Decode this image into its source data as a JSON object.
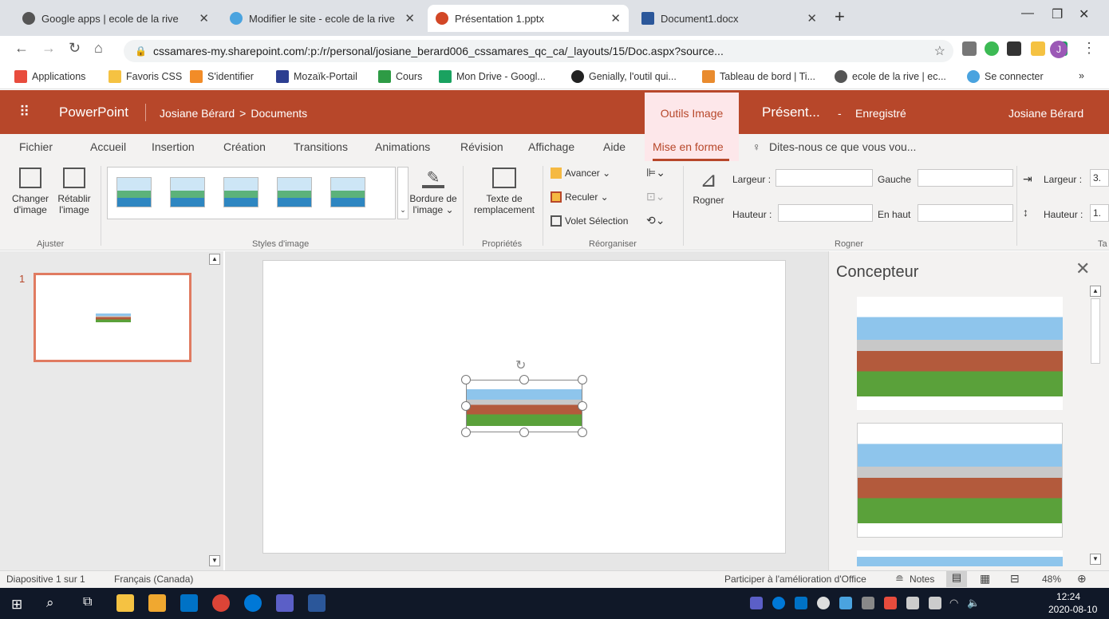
{
  "browser": {
    "tabs": [
      {
        "label": "Google apps | ecole de la rive",
        "color": "#555555"
      },
      {
        "label": "Modifier le site - ecole de la rive",
        "color": "#4aa3df"
      },
      {
        "label": "Présentation 1.pptx",
        "color": "#d24726"
      },
      {
        "label": "Document1.docx",
        "color": "#2b579a"
      }
    ],
    "new_tab": "+",
    "url": "cssamares-my.sharepoint.com/:p:/r/personal/josiane_berard006_cssamares_qc_ca/_layouts/15/Doc.aspx?source...",
    "profile_initial": "J",
    "bookmarks": [
      {
        "label": "Applications",
        "color": "#e84c3d"
      },
      {
        "label": "Favoris CSS",
        "color": "#f5c242"
      },
      {
        "label": "S'identifier",
        "color": "#f28c28"
      },
      {
        "label": "Mozaïk-Portail",
        "color": "#2c3e91"
      },
      {
        "label": "Cours",
        "color": "#2e9b45"
      },
      {
        "label": "Mon Drive - Googl...",
        "color": "#1aa260"
      },
      {
        "label": "Genially, l'outil qui...",
        "color": "#222222"
      },
      {
        "label": "Tableau de bord | Ti...",
        "color": "#e98b2e"
      },
      {
        "label": "ecole de la rive | ec...",
        "color": "#555555"
      },
      {
        "label": "Se connecter",
        "color": "#4aa3df"
      }
    ],
    "bookmarks_more": "»"
  },
  "app": {
    "name": "PowerPoint",
    "breadcrumb_user": "Josiane Bérard",
    "breadcrumb_sep": ">",
    "breadcrumb_folder": "Documents",
    "context_tab": "Outils Image",
    "doc_title": "Présent...",
    "save_status": "Enregistré",
    "save_dash": "-",
    "user": "Josiane Bérard",
    "accent": "#b7472a"
  },
  "ribbon_tabs": [
    "Fichier",
    "Accueil",
    "Insertion",
    "Création",
    "Transitions",
    "Animations",
    "Révision",
    "Affichage",
    "Aide",
    "Mise en forme"
  ],
  "tell_me": "Dites-nous ce que vous vou...",
  "ribbon": {
    "change_image": [
      "Changer",
      "d'image"
    ],
    "reset_image": [
      "Rétablir",
      "l'image"
    ],
    "group_adjust": "Ajuster",
    "border": [
      "Bordure de",
      "l'image ⌄"
    ],
    "group_styles": "Styles d'image",
    "alt_text": [
      "Texte de",
      "remplacement"
    ],
    "group_props": "Propriétés",
    "forward": "Avancer ⌄",
    "backward": "Reculer ⌄",
    "selection_pane": "Volet Sélection",
    "group_arrange": "Réorganiser",
    "crop": "Rogner",
    "width_label": "Largeur :",
    "height_label": "Hauteur :",
    "left_label": "Gauche",
    "top_label": "En haut",
    "group_crop": "Rogner",
    "size_width_label": "Largeur :",
    "size_height_label": "Hauteur :",
    "size_width_value": "3.",
    "size_height_value": "1.",
    "group_size_partial": "Ta"
  },
  "thumbnails": {
    "slide_number": "1"
  },
  "designer": {
    "title": "Concepteur"
  },
  "status": {
    "slide_info": "Diapositive 1 sur 1",
    "language": "Français (Canada)",
    "feedback": "Participer à l'amélioration d'Office",
    "notes": "Notes",
    "zoom": "48%"
  },
  "taskbar": {
    "time": "12:24",
    "date": "2020-08-10"
  }
}
